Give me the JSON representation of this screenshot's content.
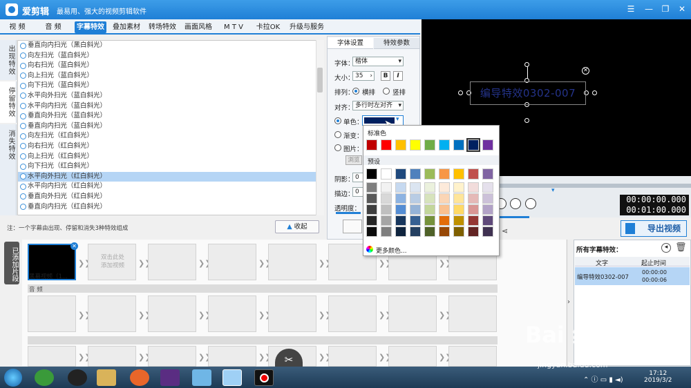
{
  "app": {
    "name": "爱剪辑",
    "slogan": "最易用、强大的视频剪辑软件"
  },
  "menu": [
    {
      "label": "视  频"
    },
    {
      "label": "音  频"
    },
    {
      "label": "字幕特效"
    },
    {
      "label": "叠加素材"
    },
    {
      "label": "转场特效"
    },
    {
      "label": "画面风格"
    },
    {
      "label": "M T V"
    },
    {
      "label": "卡拉OK"
    },
    {
      "label": "升级与服务"
    }
  ],
  "left_tabs": [
    {
      "label": "出现特效"
    },
    {
      "label": "停留特效"
    },
    {
      "label": "消失特效"
    }
  ],
  "effects": [
    {
      "label": "垂直向内扫光（黑白斜光）"
    },
    {
      "label": "向左扫光（蓝白斜光）"
    },
    {
      "label": "向右扫光（蓝白斜光）"
    },
    {
      "label": "向上扫光（蓝白斜光）"
    },
    {
      "label": "向下扫光（蓝白斜光）"
    },
    {
      "label": "水平向外扫光（蓝白斜光）"
    },
    {
      "label": "水平向内扫光（蓝白斜光）"
    },
    {
      "label": "垂直向外扫光（蓝白斜光）"
    },
    {
      "label": "垂直向内扫光（蓝白斜光）"
    },
    {
      "label": "向左扫光（红白斜光）"
    },
    {
      "label": "向右扫光（红白斜光）"
    },
    {
      "label": "向上扫光（红白斜光）"
    },
    {
      "label": "向下扫光（红白斜光）"
    },
    {
      "label": "水平向外扫光（红白斜光）"
    },
    {
      "label": "水平向内扫光（红白斜光）"
    },
    {
      "label": "垂直向外扫光（红白斜光）"
    },
    {
      "label": "垂直向内扫光（红白斜光）"
    }
  ],
  "note": "注：一个字幕由出现、停留和消失3种特效组成",
  "collapse_label": "收起",
  "props": {
    "tab_font": "字体设置",
    "tab_effect": "特效参数",
    "font_label": "字体：",
    "font_value": "楷体",
    "size_label": "大小：",
    "size_value": "35",
    "bold": "B",
    "italic": "I",
    "layout_label": "排列：",
    "horizontal": "横排",
    "vertical": "竖排",
    "align_label": "对齐：",
    "align_value": "多行时左对齐",
    "solid_label": "单色：",
    "gradient_label": "渐变：",
    "image_label": "图片：",
    "browse": "浏览",
    "shadow_label": "阴影：",
    "shadow_value": "0",
    "stroke_label": "描边：",
    "stroke_value": "0",
    "opacity_label": "透明度："
  },
  "color_popup": {
    "standard_label": "标准色",
    "preset_label": "预设",
    "more_label": "更多颜色...",
    "standard_colors": [
      "#c00000",
      "#ff0000",
      "#ffc000",
      "#ffff00",
      "#70ad47",
      "#00b0f0",
      "#0070c0",
      "#002060",
      "#7030a0"
    ],
    "preset_rows": [
      [
        "#000000",
        "#ffffff",
        "#1f497d",
        "#4f81bd",
        "#9bbb59",
        "#f79646",
        "#ffc000",
        "#c0504d",
        "#8064a2"
      ],
      [
        "#7f7f7f",
        "#f2f2f2",
        "#c6d9f0",
        "#dbe5f1",
        "#ebf1dd",
        "#fdeada",
        "#fff2cc",
        "#f2dcdb",
        "#e5e0ec"
      ],
      [
        "#595959",
        "#d8d8d8",
        "#8db3e2",
        "#b8cce4",
        "#d7e3bc",
        "#fbd5b5",
        "#ffe599",
        "#e5b9b7",
        "#ccc1d9"
      ],
      [
        "#3f3f3f",
        "#bfbfbf",
        "#548dd4",
        "#95b3d7",
        "#c3d69b",
        "#fac08f",
        "#ffd966",
        "#d99694",
        "#b2a2c7"
      ],
      [
        "#262626",
        "#a5a5a5",
        "#17365d",
        "#366092",
        "#76923c",
        "#e36c09",
        "#bf9000",
        "#953734",
        "#5f497a"
      ],
      [
        "#0c0c0c",
        "#7f7f7f",
        "#0f243e",
        "#244061",
        "#4f6128",
        "#974806",
        "#7f6000",
        "#632423",
        "#3f3151"
      ]
    ],
    "selected_color": "#002060"
  },
  "preview": {
    "caption": "编导特效0302-007"
  },
  "playback": {
    "current_time": "00:00:00.000",
    "total_time": "00:01:00.000",
    "export_label": "导出视频"
  },
  "timeline": {
    "clips_label": "已添加片段",
    "first_clip_label": "黑幕视频（1...",
    "add_hint_1": "双击此处",
    "add_hint_2": "添加视频",
    "audio_label": "音  频"
  },
  "captions_panel": {
    "title": "所有字幕特效：",
    "col_text": "文字",
    "col_time": "起止时间",
    "rows": [
      {
        "text": "编导特效0302-007",
        "start": "00:00:00",
        "end": "00:00:06"
      }
    ]
  },
  "taskbar": {
    "time": "17:12",
    "date": "2019/3/2"
  },
  "watermark": {
    "brand": "Bai 经验",
    "url": "jingyan.baidu.com"
  }
}
